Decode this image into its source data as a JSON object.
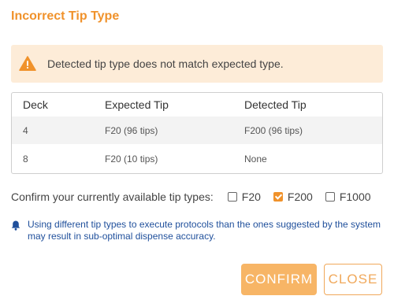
{
  "dialog": {
    "title": "Incorrect Tip Type",
    "warning": {
      "icon": "warning-triangle-icon",
      "text": "Detected tip type does not match expected type."
    },
    "table": {
      "headers": [
        "Deck",
        "Expected Tip",
        "Detected Tip"
      ],
      "rows": [
        {
          "deck": "4",
          "expected": "F20 (96 tips)",
          "detected": "F200 (96 tips)"
        },
        {
          "deck": "8",
          "expected": "F20 (10 tips)",
          "detected": "None"
        }
      ]
    },
    "confirm": {
      "label": "Confirm your currently available tip types:",
      "options": [
        {
          "label": "F20",
          "checked": false
        },
        {
          "label": "F200",
          "checked": true
        },
        {
          "label": "F1000",
          "checked": false
        }
      ]
    },
    "note": {
      "icon": "bell-icon",
      "text": "Using different tip types to execute protocols than the ones suggested by the system may result in sub-optimal dispense accuracy."
    },
    "buttons": {
      "confirm": "CONFIRM",
      "close": "CLOSE"
    },
    "colors": {
      "accent": "#f0922b",
      "warning_bg": "#fdecd8",
      "note_text": "#1f4f9b",
      "confirm_bg": "#f7b566"
    }
  }
}
